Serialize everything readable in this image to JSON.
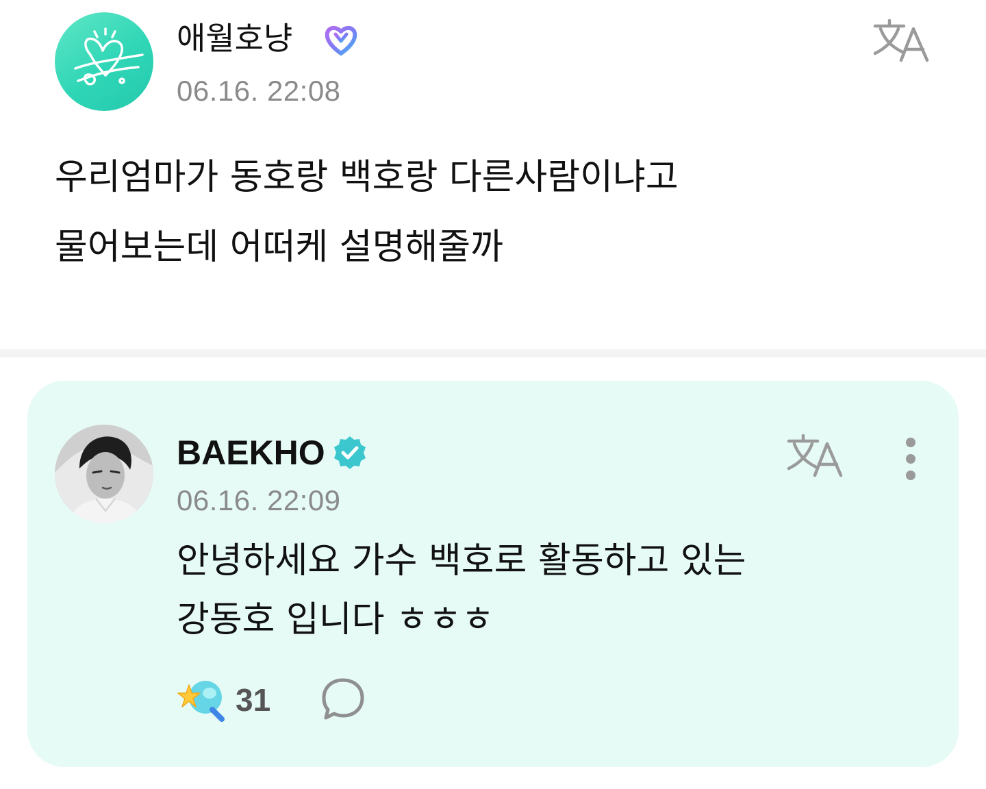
{
  "post": {
    "author": "애월호냥",
    "timestamp": "06.16. 22:08",
    "body_lines": [
      "우리엄마가 동호랑 백호랑 다른사람이냐고",
      "물어보는데 어떠케 설명해줄까"
    ],
    "avatar_icon": "heart-logo-icon",
    "badge_icon": "fan-heart-badge-icon",
    "translate_icon": "translate-icon"
  },
  "reply": {
    "author": "BAEKHO",
    "timestamp": "06.16. 22:09",
    "body_lines": [
      "안녕하세요 가수 백호로 활동하고 있는",
      "강동호 입니다 ㅎㅎㅎ"
    ],
    "like_count": "31",
    "badge_icon": "verified-badge-icon",
    "translate_icon": "translate-icon",
    "more_icon": "more-vertical-icon",
    "like_icon": "star-wand-icon",
    "comment_icon": "comment-bubble-icon"
  },
  "colors": {
    "card_bg": "#e6fbf6",
    "accent_mint": "#3ed8bc",
    "verified": "#3cc7cf",
    "timestamp_gray": "#8a8a8a",
    "divider": "#f3f3f3"
  }
}
